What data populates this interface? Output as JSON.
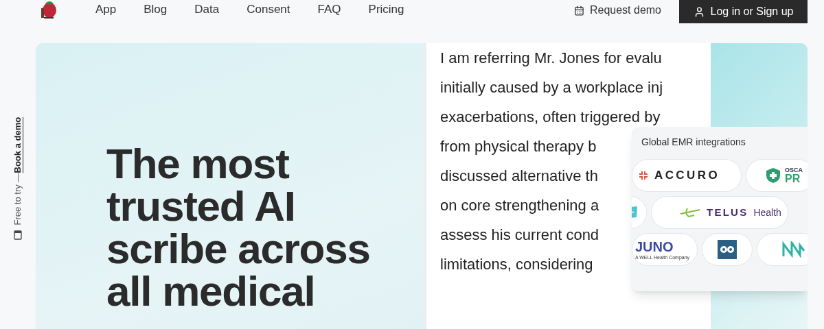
{
  "nav": {
    "links": [
      {
        "label": "App"
      },
      {
        "label": "Blog"
      },
      {
        "label": "Data"
      },
      {
        "label": "Consent"
      },
      {
        "label": "FAQ"
      },
      {
        "label": "Pricing"
      }
    ],
    "request_demo": "Request demo",
    "login": "Log in or Sign up"
  },
  "side_note": {
    "text": "Free to try —",
    "link": "Book a demo"
  },
  "hero": {
    "headline": [
      "The most",
      "trusted AI",
      "scribe across",
      "all medical"
    ]
  },
  "document": {
    "lines": [
      "I am referring Mr. Jones for evalu",
      "initially caused by a workplace inj",
      "exacerbations, often triggered by",
      "from physical therapy b",
      "discussed alternative th",
      "on core strengthening a",
      "assess his current cond",
      "limitations, considering"
    ]
  },
  "integrations": {
    "title": "Global EMR integrations",
    "rows": [
      [
        {
          "kind": "accuro",
          "text": "ACCURO"
        },
        {
          "kind": "oscar",
          "text": "OSCA",
          "sub": "PR"
        }
      ],
      [
        {
          "kind": "jane"
        },
        {
          "kind": "telus",
          "text": "TELUS",
          "sub": "Health"
        }
      ],
      [
        {
          "kind": "juno",
          "text": "JUNO",
          "sub": "A WELL Health Company"
        },
        {
          "kind": "owl"
        },
        {
          "kind": "wave"
        }
      ]
    ]
  }
}
